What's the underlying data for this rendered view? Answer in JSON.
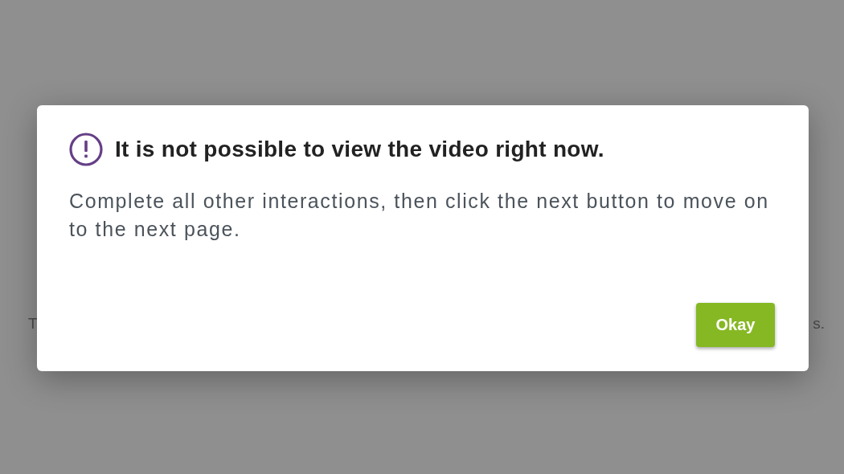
{
  "background": {
    "left_text": "T",
    "right_text": "s."
  },
  "dialog": {
    "title": "It is not possible to view the video right now.",
    "message": "Complete all other interactions, then click the next button to move on to the next page.",
    "buttons": [
      "Okay"
    ]
  }
}
